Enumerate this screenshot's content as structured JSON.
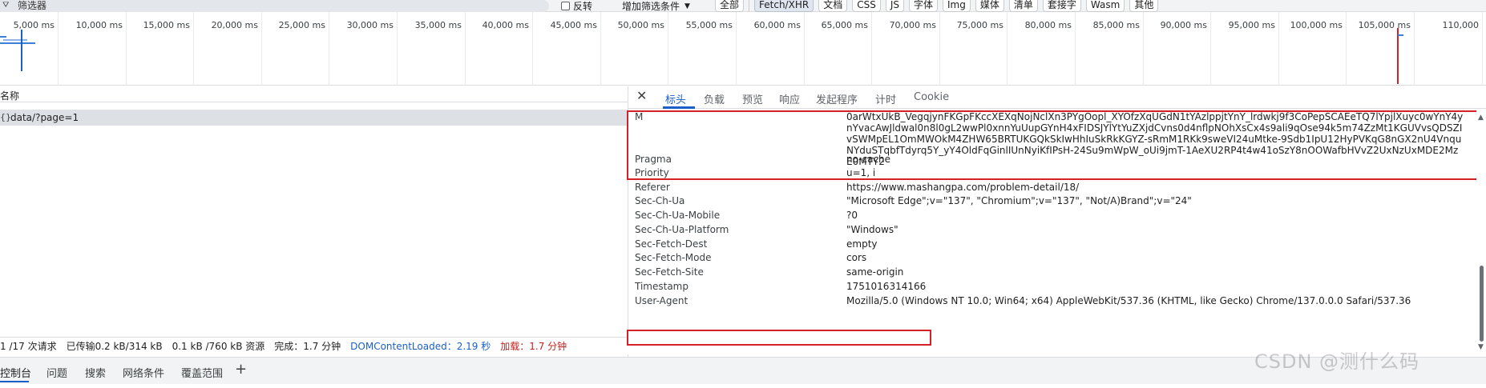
{
  "filter_bar": {
    "filter_placeholder": "筛选器",
    "filter_icon": "funnel-icon",
    "invert_label": "反转",
    "more_filters_label": "增加筛选条件",
    "type_chips": [
      "全部",
      "Fetch/XHR",
      "文档",
      "CSS",
      "JS",
      "字体",
      "Img",
      "媒体",
      "清单",
      "套接字",
      "Wasm",
      "其他"
    ],
    "active_chip": "Fetch/XHR"
  },
  "timeline": {
    "ticks": [
      "5,000 ms",
      "10,000 ms",
      "15,000 ms",
      "20,000 ms",
      "25,000 ms",
      "30,000 ms",
      "35,000 ms",
      "40,000 ms",
      "45,000 ms",
      "50,000 ms",
      "55,000 ms",
      "60,000 ms",
      "65,000 ms",
      "70,000 ms",
      "75,000 ms",
      "80,000 ms",
      "85,000 ms",
      "90,000 ms",
      "95,000 ms",
      "100,000 ms",
      "105,000 ms",
      "110,000"
    ],
    "dom_content_loaded_color": "#1a5fc8",
    "load_color": "#d42027"
  },
  "request_list": {
    "column_header": "名称",
    "rows": [
      {
        "icon": "xhr-icon",
        "name": "data/?page=1"
      }
    ]
  },
  "status_bar": {
    "requests": "1 /17 次请求",
    "transferred": "已传输0.2 kB/314 kB",
    "resources": "0.1 kB /760 kB 资源",
    "finish": "完成：1.7 分钟",
    "dom_content_loaded": "DOMContentLoaded：2.19 秒",
    "load": "加载：1.7 分钟"
  },
  "detail_tabs": {
    "close_icon": "close-icon",
    "tabs": [
      "标头",
      "负载",
      "预览",
      "响应",
      "发起程序",
      "计时",
      "Cookie"
    ],
    "active_tab": "标头"
  },
  "headers": {
    "m_key": "M",
    "m_value": "0arWtxUkB_VegqjynFKGpFKccXEXqNojNclXn3PYgOopl_XYOfzXqUGdN1tYAzlppjtYnY_lrdwkj9f3CoPepSCAEeTQ7lYpjlXuyc0wYnY4ynYvacAwJldwal0n8l0gL2wwPl0xnnYuUupGYnH4xFIDSJYlYtYuZXjdCvns0d4nflpNOhXsCx4s9ali9qOse94k5m74ZzMt1KGUVvsQDSZIvSWMpEL1OmMWOkM4ZHW65BRTUKGQkSkIwHhIuSkRkKGYZ-sRmM1RKk9sweVI24uMtke-9Sdb1IpU12HyPVKqG8nGX2nU4VnquNYduSTqbfTdyrq5Y_yY4OldFqGinlIUnNyiKfIPsH-24Su9mWpW_oUi9jmT-1AeXU2RP4t4w41oSzY8nOOWafbHVvZ2UxNzUxMDE2MzE0MTY2",
    "rows": [
      {
        "key": "Pragma",
        "value": "no-cache"
      },
      {
        "key": "Priority",
        "value": "u=1, i"
      },
      {
        "key": "Referer",
        "value": "https://www.mashangpa.com/problem-detail/18/"
      },
      {
        "key": "Sec-Ch-Ua",
        "value": "\"Microsoft Edge\";v=\"137\", \"Chromium\";v=\"137\", \"Not/A)Brand\";v=\"24\""
      },
      {
        "key": "Sec-Ch-Ua-Mobile",
        "value": "?0"
      },
      {
        "key": "Sec-Ch-Ua-Platform",
        "value": "\"Windows\""
      },
      {
        "key": "Sec-Fetch-Dest",
        "value": "empty"
      },
      {
        "key": "Sec-Fetch-Mode",
        "value": "cors"
      },
      {
        "key": "Sec-Fetch-Site",
        "value": "same-origin"
      },
      {
        "key": "Timestamp",
        "value": "1751016314166"
      },
      {
        "key": "User-Agent",
        "value": "Mozilla/5.0 (Windows NT 10.0; Win64; x64) AppleWebKit/537.36 (KHTML, like Gecko) Chrome/137.0.0.0 Safari/537.36"
      }
    ],
    "highlight_color": "#d42027"
  },
  "drawer": {
    "tabs": [
      "控制台",
      "问题",
      "搜索",
      "网络条件",
      "覆盖范围"
    ],
    "active_tab": "控制台",
    "add_icon": "plus-icon"
  },
  "watermark": "CSDN @测什么码"
}
